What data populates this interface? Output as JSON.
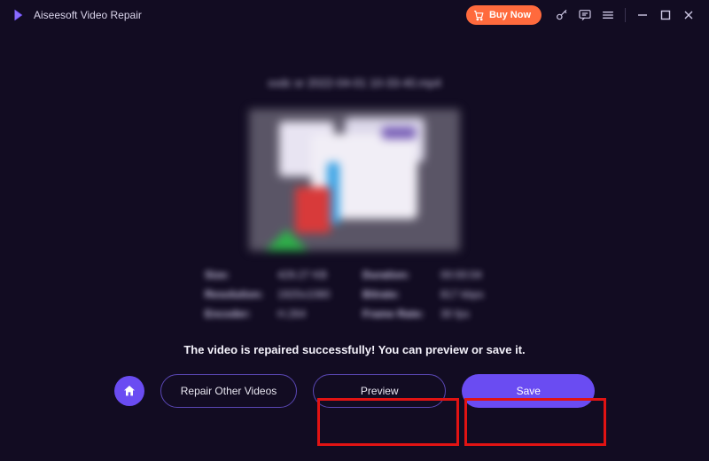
{
  "titlebar": {
    "app_title": "Aiseesoft Video Repair",
    "buy_label": "Buy Now"
  },
  "result": {
    "filename": "xxdc sr 2022-04-01 10-33-40.mp4",
    "meta": {
      "size_label": "Size:",
      "size_value": "429.27 KB",
      "duration_label": "Duration:",
      "duration_value": "00:00:04",
      "resolution_label": "Resolution:",
      "resolution_value": "1920x1080",
      "bitrate_label": "Bitrate:",
      "bitrate_value": "817 kbps",
      "encoder_label": "Encoder:",
      "encoder_value": "H.264",
      "framerate_label": "Frame Rate:",
      "framerate_value": "30 fps"
    },
    "status_text": "The video is repaired successfully! You can preview or save it."
  },
  "actions": {
    "repair_other_label": "Repair Other Videos",
    "preview_label": "Preview",
    "save_label": "Save"
  },
  "colors": {
    "accent": "#6a4cf2",
    "buy": "#ff6a3d",
    "highlight": "#e11313"
  }
}
